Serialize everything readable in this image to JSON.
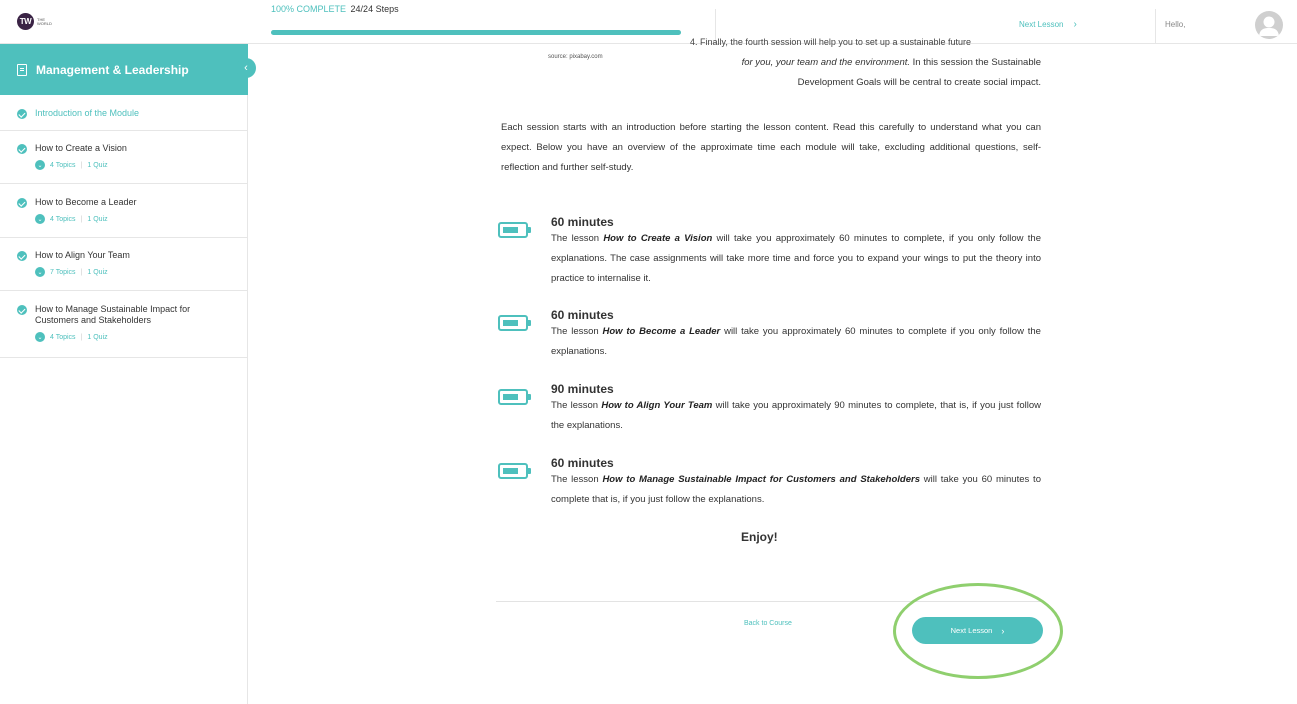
{
  "header": {
    "logo_text": "TW",
    "logo_subtext": "THE WORLD",
    "progress_percent_label": "100% COMPLETE",
    "progress_steps": "24/24 Steps",
    "progress_fraction": 1.0,
    "next_lesson_label": "Next Lesson",
    "greeting": "Hello,"
  },
  "sidebar": {
    "title": "Management & Leadership",
    "items": [
      {
        "label": "Introduction of the Module",
        "active": true
      },
      {
        "label": "How to Create a Vision",
        "topics": "4 Topics",
        "quiz": "1 Quiz"
      },
      {
        "label": "How to Become a Leader",
        "topics": "4 Topics",
        "quiz": "1 Quiz"
      },
      {
        "label": "How to Align Your Team",
        "topics": "7 Topics",
        "quiz": "1 Quiz"
      },
      {
        "label": "How to Manage Sustainable Impact for Customers and Stakeholders",
        "topics": "4 Topics",
        "quiz": "1 Quiz"
      }
    ]
  },
  "content": {
    "image_caption": "source: pixabay.com",
    "clipped_line": "4. Finally, the fourth session will help you to set up a sustainable future",
    "intro_line_1": "for you, your team and the environment.",
    "intro_line_1_rest": " In this session the Sustainable",
    "intro_line_2": "Development Goals will be central to create social impact.",
    "paragraph": "Each session starts with an introduction before starting the lesson content. Read this carefully to understand what you can expect. Below you have an overview of the approximate time each module will take, excluding additional questions, self-reflection and further self-study.",
    "items": [
      {
        "title": "60 minutes",
        "pre": "The lesson ",
        "lesson": "How to Create a Vision",
        "post": " will take you approximately 60 minutes to complete, if you only follow the explanations. The case assignments will take more time and force you to expand your wings to put the theory into practice to internalise it."
      },
      {
        "title": "60 minutes",
        "pre": "The lesson ",
        "lesson": "How to Become a Leader",
        "post": " will take you approximately 60 minutes to complete if you only follow the explanations."
      },
      {
        "title": "90 minutes",
        "pre": "The lesson ",
        "lesson": "How to Align Your Team",
        "post": " will take you approximately 90 minutes to complete, that is, if you just follow the explanations."
      },
      {
        "title": "60 minutes",
        "pre": "The lesson ",
        "lesson": "How to Manage Sustainable Impact for Customers and Stakeholders",
        "post": " will take you 60 minutes to complete that is, if you just follow the explanations."
      }
    ],
    "enjoy": "Enjoy!"
  },
  "footer_nav": {
    "back_label": "Back to Course",
    "next_label": "Next Lesson"
  },
  "colors": {
    "accent": "#4ec0bd",
    "highlight_ring": "#8fcf6e"
  },
  "icons": {
    "duration": "battery-icon",
    "complete": "check-circle-icon",
    "expand": "chevron-down-icon",
    "collapse": "chevron-left-icon",
    "profile": "user-avatar-icon",
    "module": "book-icon"
  }
}
